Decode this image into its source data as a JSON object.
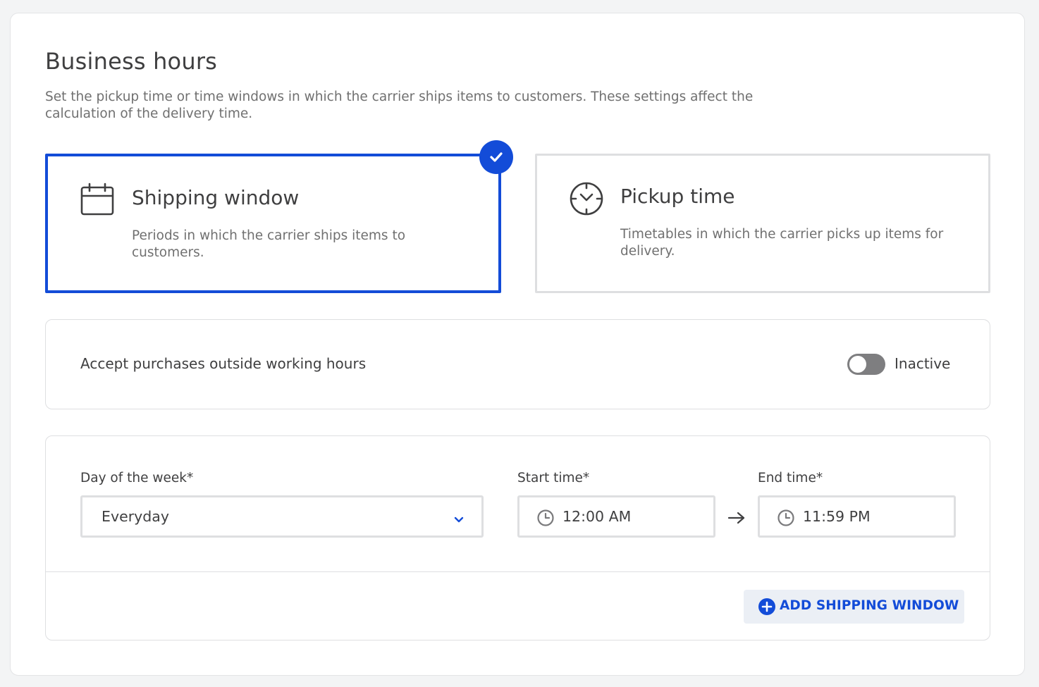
{
  "page": {
    "title": "Business hours",
    "description": "Set the pickup time or time windows in which the carrier ships items to customers. These settings affect the calculation of the delivery time."
  },
  "options": [
    {
      "title": "Shipping window",
      "description": "Periods in which the carrier ships items to customers.",
      "icon": "calendar-icon",
      "selected": true
    },
    {
      "title": "Pickup time",
      "description": "Timetables in which the carrier picks up items for delivery.",
      "icon": "clock-icon",
      "selected": false
    }
  ],
  "accept_outside_hours": {
    "label": "Accept purchases outside working hours",
    "status": "Inactive",
    "active": false
  },
  "shipping_window": {
    "day_label": "Day of the week*",
    "day_value": "Everyday",
    "start_label": "Start time*",
    "start_value": "12:00 AM",
    "end_label": "End time*",
    "end_value": "11:59 PM"
  },
  "add_button": {
    "label": "ADD SHIPPING WINDOW"
  },
  "colors": {
    "accent": "#134cd8",
    "border": "#dedfe1",
    "text": "#3f3f40",
    "muted": "#707070",
    "toggle_off": "#7e7e80"
  }
}
